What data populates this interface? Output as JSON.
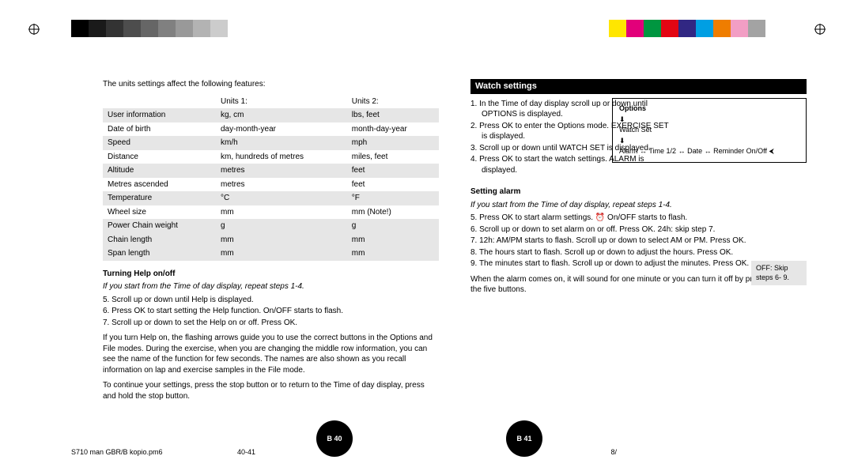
{
  "left": {
    "intro": "The units settings affect the following features:",
    "table": {
      "head": [
        "",
        "Units 1:",
        "Units 2:"
      ],
      "rows": [
        {
          "z": true,
          "c": [
            "User information",
            "kg, cm",
            "lbs, feet"
          ]
        },
        {
          "z": false,
          "c": [
            "Date of birth",
            "day-month-year",
            "month-day-year"
          ]
        },
        {
          "z": true,
          "c": [
            "Speed",
            "km/h",
            "mph"
          ]
        },
        {
          "z": false,
          "c": [
            "Distance",
            "km, hundreds of metres",
            "miles, feet"
          ]
        },
        {
          "z": true,
          "c": [
            "Altitude",
            "metres",
            "feet"
          ]
        },
        {
          "z": false,
          "c": [
            "Metres ascended",
            "metres",
            "feet"
          ]
        },
        {
          "z": true,
          "c": [
            "Temperature",
            "°C",
            "°F"
          ]
        },
        {
          "z": false,
          "c": [
            "Wheel size",
            "mm",
            "mm (Note!)"
          ]
        },
        {
          "z": true,
          "c": [
            "Power  Chain weight",
            "g",
            "g"
          ],
          "sub": false
        },
        {
          "z": true,
          "c": [
            "Chain length",
            "mm",
            "mm"
          ],
          "sub": true
        },
        {
          "z": true,
          "c": [
            "Span length",
            "mm",
            "mm"
          ],
          "sub": true
        }
      ]
    },
    "help_h": "Turning Help on/off",
    "help_intro": "If you start from the Time of day display, repeat steps 1-4.",
    "help_steps": [
      "5. Scroll up or down until Help is displayed.",
      "6. Press OK to start setting the Help function. On/OFF starts to flash.",
      "7. Scroll up or down to set the Help on or off. Press OK."
    ],
    "help_p1": "If you turn Help on, the flashing arrows guide you to use the correct buttons in the Options and File modes. During the exercise, when you are changing the middle row information, you can see the name of the function for few seconds. The names are also shown as you recall information on lap and exercise samples in the File mode.",
    "help_p2": "To continue your settings, press the stop button or to return to the Time of day display, press and hold the stop button.",
    "pg": "B 40"
  },
  "right": {
    "heading": "Watch settings",
    "watch_steps": [
      "1. In the Time of day display scroll up or down until OPTIONS is displayed.",
      "2. Press OK to enter the Options mode. EXERCISE SET is displayed.",
      "3. Scroll up or down until WATCH SET is displayed.",
      "4. Press OK to start the watch settings. ALARM is displayed."
    ],
    "diag": {
      "options": "Options",
      "watchset": "Watch Set",
      "alarm": "Alarm",
      "time": "Time 1/2",
      "date": "Date",
      "rem": "Reminder On/Off"
    },
    "alarm_h": "Setting alarm",
    "alarm_intro": "If you start from the Time of day display, repeat steps 1-4.",
    "alarm_steps": [
      "5. Press OK to start alarm settings. ⏰ On/OFF starts to flash.",
      "6. Scroll up or down to set alarm on or off. Press OK. 24h: skip step 7.",
      "7. 12h: AM/PM starts to flash. Scroll up or down to select AM or PM. Press OK.",
      "8. The hours start to flash. Scroll up or down to adjust the hours. Press OK.",
      "9. The minutes start to flash. Scroll up or down to adjust the minutes. Press OK."
    ],
    "note": {
      "l1": "OFF: Skip",
      "l2": "steps 6- 9."
    },
    "alarm_p": "When the alarm comes on, it will sound for one minute or you can turn it off by pressing any of the five buttons.",
    "pg": "B 41"
  },
  "footer": {
    "file": "S710 man GBR/B kopio.pm6",
    "pages": "40-41",
    "time": "8/"
  },
  "greys": [
    "#000000",
    "#1a1a1a",
    "#333333",
    "#4d4d4d",
    "#666666",
    "#808080",
    "#999999",
    "#b3b3b3",
    "#cccccc",
    "#ffffff"
  ],
  "colors": [
    "#ffe600",
    "#e2007a",
    "#009640",
    "#e30613",
    "#312783",
    "#009fe3",
    "#ef7d00",
    "#f29ec4",
    "#a3a3a3",
    "#ffffff"
  ]
}
